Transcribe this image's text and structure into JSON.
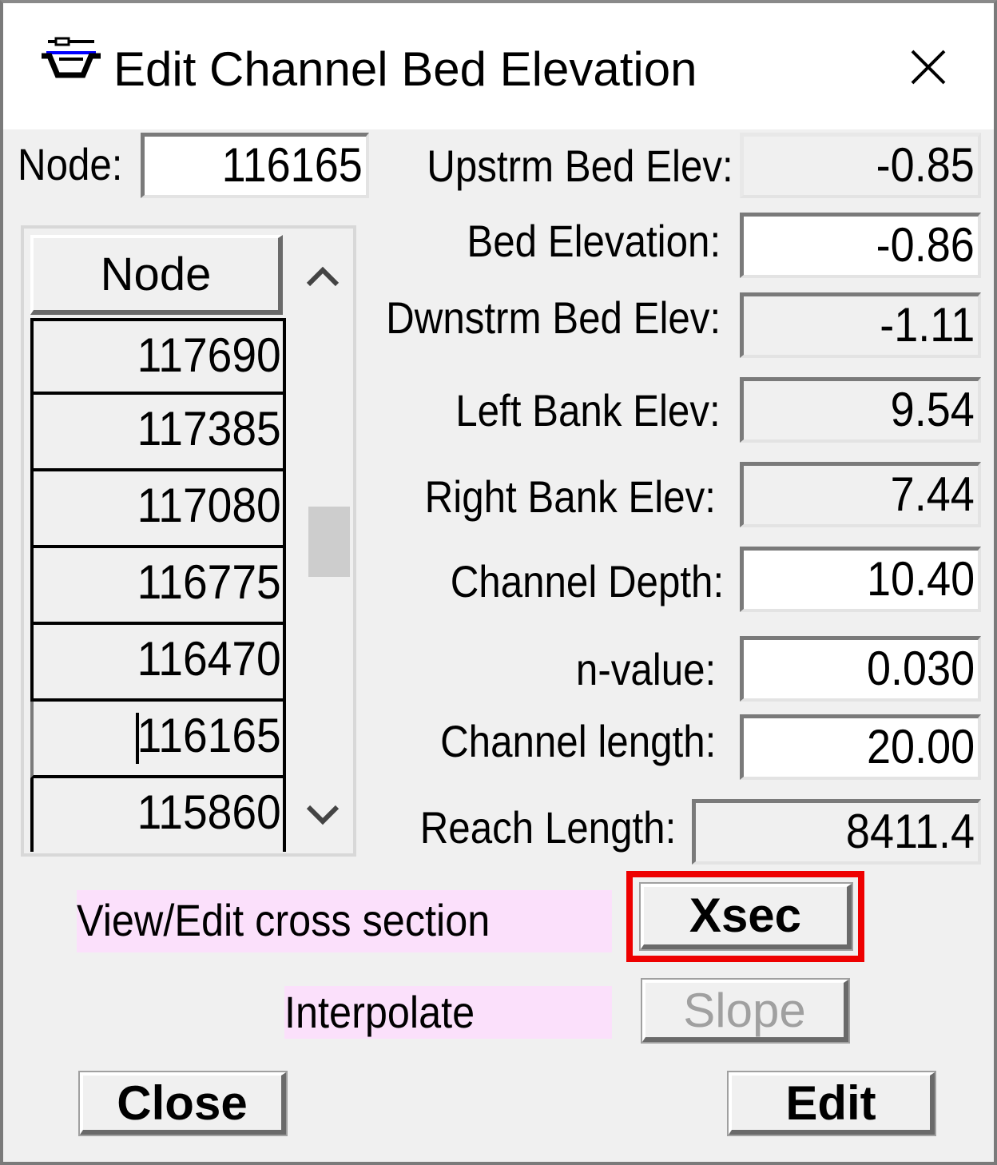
{
  "window": {
    "title": "Edit Channel Bed Elevation"
  },
  "node_label": "Node:",
  "node_value": "116165",
  "fields": {
    "upstrm_bed_elev": {
      "label": "Upstrm Bed Elev:",
      "value": "-0.85"
    },
    "bed_elevation": {
      "label": "Bed Elevation:",
      "value": "-0.86"
    },
    "dwnstrm_bed_elev": {
      "label": "Dwnstrm Bed Elev:",
      "value": "-1.11"
    },
    "left_bank_elev": {
      "label": "Left Bank Elev:",
      "value": "9.54"
    },
    "right_bank_elev": {
      "label": "Right Bank Elev:",
      "value": "7.44"
    },
    "channel_depth": {
      "label": "Channel Depth:",
      "value": "10.40"
    },
    "n_value": {
      "label": "n-value:",
      "value": "0.030"
    },
    "channel_length": {
      "label": "Channel length:",
      "value": "20.00"
    },
    "reach_length": {
      "label": "Reach  Length:",
      "value": "8411.4"
    }
  },
  "node_grid": {
    "header": "Node",
    "rows": [
      "117690",
      "117385",
      "117080",
      "116775",
      "116470",
      "116165",
      "115860"
    ],
    "scroll_up_icon": "chevron-up-icon",
    "scroll_down_icon": "chevron-down-icon"
  },
  "hints": {
    "xsec_hint": "View/Edit cross section",
    "slope_hint": "Interpolate"
  },
  "buttons": {
    "xsec": "Xsec",
    "slope": "Slope",
    "close": "Close",
    "edit": "Edit"
  },
  "colors": {
    "hint_background": "#fbe0fb",
    "highlight": "#ee0000",
    "dialog_background": "#f0f0f0"
  }
}
